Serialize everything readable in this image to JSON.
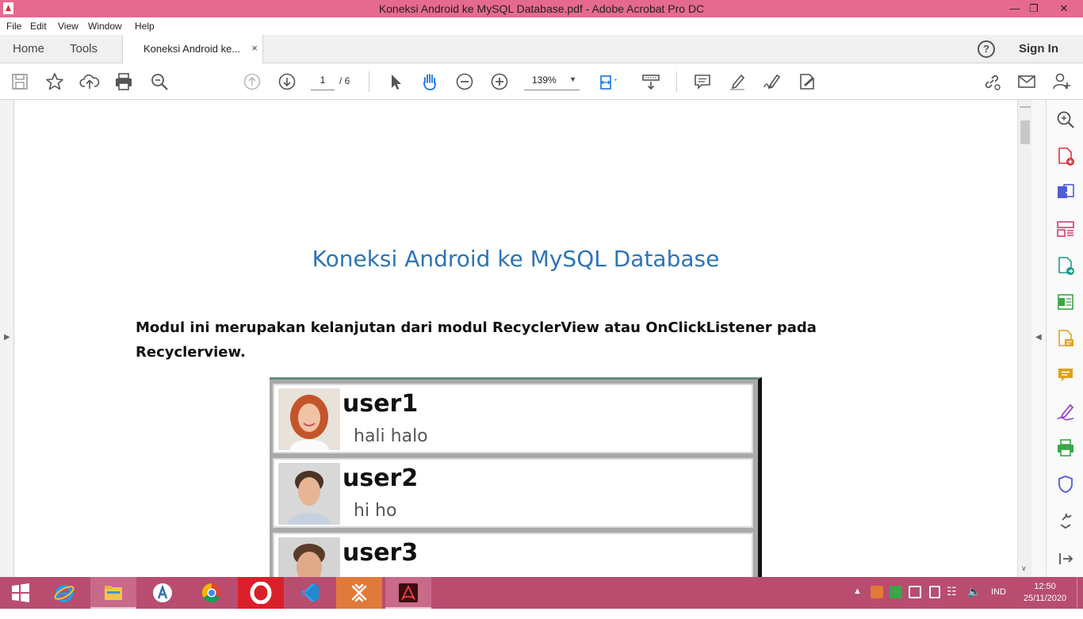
{
  "window": {
    "title": "Koneksi Android ke MySQL Database.pdf - Adobe Acrobat Pro DC"
  },
  "menu": {
    "items": [
      "File",
      "Edit",
      "View",
      "Window",
      "Help"
    ]
  },
  "tabs": {
    "home": "Home",
    "tools": "Tools",
    "document": "Koneksi Android ke...",
    "close": "×"
  },
  "account": {
    "help": "?",
    "signin": "Sign In"
  },
  "toolbar": {
    "page_current": "1",
    "page_total": "/ 6",
    "zoom": "139%"
  },
  "document": {
    "title": "Koneksi Android ke MySQL Database",
    "paragraph": "Modul ini merupakan kelanjutan dari modul RecyclerView atau OnClickListener pada Recyclerview.",
    "list": [
      {
        "name": "user1",
        "message": "hali halo"
      },
      {
        "name": "user2",
        "message": "hi ho"
      },
      {
        "name": "user3",
        "message": ""
      }
    ]
  },
  "taskbar": {
    "language": "IND",
    "time": "12:50",
    "date": "25/11/2020"
  },
  "colors": {
    "titlebar": "#e66a8f",
    "taskbar": "#b84d70",
    "heading": "#2e74b5"
  }
}
